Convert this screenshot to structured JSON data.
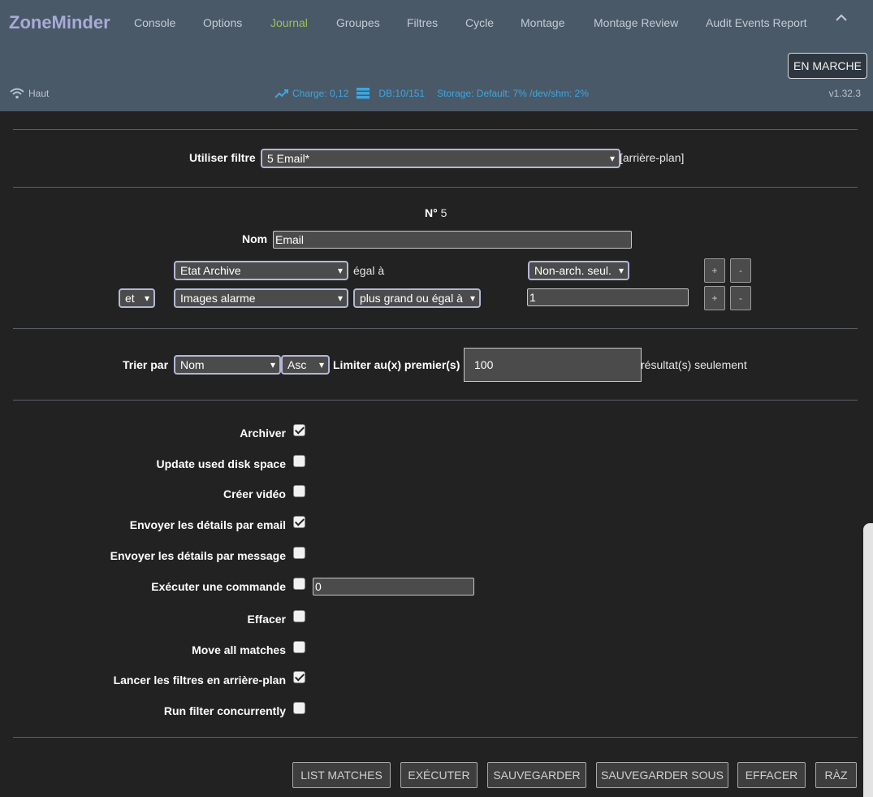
{
  "header": {
    "brand": "ZoneMinder",
    "nav": [
      "Console",
      "Options",
      "Journal",
      "Groupes",
      "Filtres",
      "Cycle",
      "Montage",
      "Montage Review",
      "Audit Events Report"
    ],
    "active_nav": "Journal",
    "state_button": "EN MARCHE",
    "status": {
      "wifi_label": "Haut",
      "load": "Charge: 0,12",
      "db": "DB:10/151",
      "storage": "Storage: Default: 7% /dev/shm: 2%",
      "version": "v1.32.3"
    }
  },
  "filter": {
    "use_label": "Utiliser filtre",
    "selected": "5 Email*",
    "background_note": "[arrière-plan]",
    "id_label": "N°",
    "id_value": "5",
    "name_label": "Nom",
    "name_value": "Email",
    "terms": [
      {
        "conj": "",
        "attr": "Etat Archive",
        "op": "égal à",
        "value": "Non-arch. seul."
      },
      {
        "conj": "et",
        "attr": "Images alarme",
        "op": "plus grand ou égal à",
        "value": "1"
      }
    ],
    "add_label": "+",
    "remove_label": "-"
  },
  "sort": {
    "label": "Trier par",
    "field": "Nom",
    "direction": "Asc",
    "limit_label": "Limiter au(x) premier(s)",
    "limit_value": "100",
    "limit_suffix": "résultat(s) seulement"
  },
  "actions": {
    "options": [
      {
        "label": "Archiver",
        "checked": true
      },
      {
        "label": "Update used disk space",
        "checked": false
      },
      {
        "label": "Créer vidéo",
        "checked": false
      },
      {
        "label": "Envoyer les détails par email",
        "checked": true
      },
      {
        "label": "Envoyer les détails par message",
        "checked": false
      },
      {
        "label": "Exécuter une commande",
        "checked": false,
        "input": "0"
      },
      {
        "label": "Effacer",
        "checked": false
      },
      {
        "label": "Move all matches",
        "checked": false
      },
      {
        "label": "Lancer les filtres en arrière-plan",
        "checked": true
      },
      {
        "label": "Run filter concurrently",
        "checked": false
      }
    ],
    "buttons": [
      "LIST MATCHES",
      "EXÉCUTER",
      "SAUVEGARDER",
      "SAUVEGARDER SOUS",
      "EFFACER",
      "RÀZ"
    ]
  },
  "colors": {
    "header_bg": "#4a5968",
    "brand": "#a8abd8",
    "active_nav": "#9bc35a",
    "stats": "#3da6e0",
    "page_bg": "#222222"
  },
  "icons": {
    "wifi": "wifi-icon",
    "load": "trending-up-icon",
    "db": "database-icon",
    "collapse": "chevron-up-icon"
  }
}
